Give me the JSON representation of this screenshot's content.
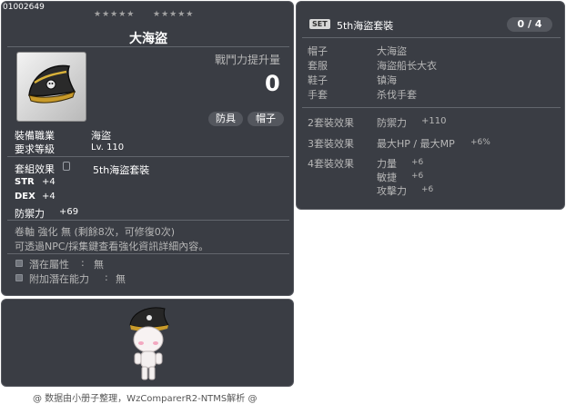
{
  "item": {
    "code": "01002649",
    "stars_left": "★★★★★",
    "stars_right": "★★★★★",
    "name": "大海盜",
    "power_label": "戰鬥力提升量",
    "power_value": "0",
    "type_primary": "防具",
    "type_secondary": "帽子",
    "job_label": "裝備職業",
    "job_value": "海盜",
    "level_label": "要求等級",
    "level_value": "Lv. 110",
    "set_label": "套組效果",
    "set_name": "5th海盜套裝",
    "stats": [
      {
        "name": "STR",
        "value": "+4"
      },
      {
        "name": "DEX",
        "value": "+4"
      },
      {
        "name": "防禦力",
        "value": "+69"
      }
    ],
    "upgrade_line": "卷軸 強化 無 (剩餘8次，可修復0次)",
    "info_line": "可透過NPC/採集鍵查看強化資訊詳細內容。",
    "potential_label": "潛在屬性",
    "potential_value": "無",
    "additional_label": "附加潛在能力",
    "additional_value": "無"
  },
  "set_panel": {
    "badge": "SET",
    "title": "5th海盜套裝",
    "count": "0 / 4",
    "pieces": [
      {
        "slot": "帽子",
        "name": "大海盜"
      },
      {
        "slot": "套服",
        "name": "海盜船长大衣"
      },
      {
        "slot": "鞋子",
        "name": "镇海"
      },
      {
        "slot": "手套",
        "name": "杀伐手套"
      }
    ],
    "effects": [
      {
        "label": "2套裝效果",
        "lines": [
          {
            "stat": "防禦力",
            "value": "+110"
          }
        ]
      },
      {
        "label": "3套裝效果",
        "lines": [
          {
            "stat": "最大HP / 最大MP",
            "value": "+6%"
          }
        ]
      },
      {
        "label": "4套裝效果",
        "lines": [
          {
            "stat": "力量",
            "value": "+6"
          },
          {
            "stat": "敏捷",
            "value": "+6"
          },
          {
            "stat": "攻擊力",
            "value": "+6"
          }
        ]
      }
    ]
  },
  "footer": {
    "credit": "@ 数据由小册子整理，WzComparerR2-NTMS解析 @"
  }
}
